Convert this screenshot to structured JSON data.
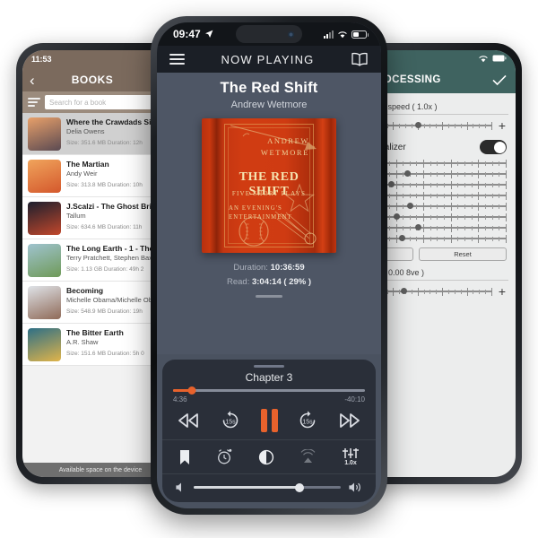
{
  "left_phone": {
    "status_time": "11:53",
    "nav_title": "BOOKS",
    "back_icon": "chevron-left-icon",
    "search_placeholder": "Search for a book",
    "footer": "Available space on the device",
    "books": [
      {
        "title": "Where the Crawdads Sin",
        "author": "Delia Owens",
        "size": "Size: 351.6 MB",
        "duration": "Duration: 12h",
        "selected": true,
        "c1": "#e8a06a",
        "c2": "#5b4a52"
      },
      {
        "title": "The Martian",
        "author": "Andy Weir",
        "size": "Size: 313.8 MB",
        "duration": "Duration: 10h",
        "selected": false,
        "c1": "#f0a45c",
        "c2": "#d4582c"
      },
      {
        "title": "J.Scalzi - The Ghost Brig",
        "author": "Tallum",
        "size": "Size: 634.6 MB",
        "duration": "Duration: 11h",
        "selected": false,
        "c1": "#1c1f2e",
        "c2": "#c2472b"
      },
      {
        "title": "The Long Earth - 1 - The",
        "author": "Terry Pratchett, Stephen Baxt",
        "size": "Size: 1.13 GB",
        "duration": "Duration: 49h 2",
        "selected": false,
        "c1": "#9fc3cf",
        "c2": "#6f9a58"
      },
      {
        "title": "Becoming",
        "author": "Michelle Obama/Michelle Oba",
        "size": "Size: 548.9 MB",
        "duration": "Duration: 19h",
        "selected": false,
        "c1": "#dfe3e8",
        "c2": "#8f6a58"
      },
      {
        "title": "The Bitter Earth",
        "author": "A.R. Shaw",
        "size": "Size: 151.6 MB",
        "duration": "Duration: 5h 0",
        "selected": false,
        "c1": "#2d6f86",
        "c2": "#e0b44a"
      }
    ]
  },
  "right_phone": {
    "nav_title": "PROCESSING",
    "confirm_icon": "checkmark-icon",
    "wifi_icon": "wifi-icon",
    "battery_icon": "battery-icon",
    "speed_label": "back speed ( 1.0x )",
    "equalizer_label": "Equalizer",
    "reset_label": "Reset",
    "pitch_label": "itch ( 0.00 8ve )",
    "plus_label": "+",
    "speed_thumb_pct": 38,
    "pitch_thumb_pct": 26,
    "eq_bands": [
      8,
      26,
      14,
      4,
      28,
      18,
      34,
      22
    ]
  },
  "center_phone": {
    "status_time": "09:47",
    "location_icon": "location-arrow-icon",
    "signal_icon": "signal-bars-icon",
    "wifi_icon": "wifi-icon",
    "battery_icon": "battery-icon",
    "menu_icon": "hamburger-menu-icon",
    "nav_title": "NOW PLAYING",
    "library_icon": "open-book-icon",
    "book_title": "The Red Shift",
    "book_author": "Andrew Wetmore",
    "cover": {
      "author_line": "ANDREW WETMORE",
      "title_line": "THE RED SHIFT",
      "sub1": "FIVE SHORT PLAYS",
      "sub2": "AN EVENING'S ENTERTAINMENT"
    },
    "duration_label": "Duration:",
    "duration_value": "10:36:59",
    "read_label": "Read:",
    "read_value": "3:04:14 ( 29% )",
    "chapter": "Chapter 3",
    "elapsed": "4:36",
    "remaining": "-40:10",
    "progress_pct": 10,
    "volume_pct": 72,
    "speed_value": "1.0x",
    "transport": {
      "prev": "previous-track-icon",
      "rewind": "rewind-15s-icon",
      "pause": "pause-icon",
      "forward": "forward-15s-icon",
      "next": "next-track-icon"
    },
    "tools": {
      "bookmark": "bookmark-icon",
      "sleep_timer": "sleep-timer-icon",
      "contrast": "dark-mode-icon",
      "airplay": "airplay-icon",
      "speed": "playback-speed-icon"
    },
    "volume_min_icon": "volume-low-icon",
    "volume_max_icon": "volume-high-icon"
  },
  "theme": {
    "accent": "#e8622c",
    "center_bg": "#4e5665",
    "player_bg": "#2a2f39",
    "left_nav": "#7b6a5d",
    "right_nav": "#3f6360",
    "page_bg": "#ffffff"
  }
}
